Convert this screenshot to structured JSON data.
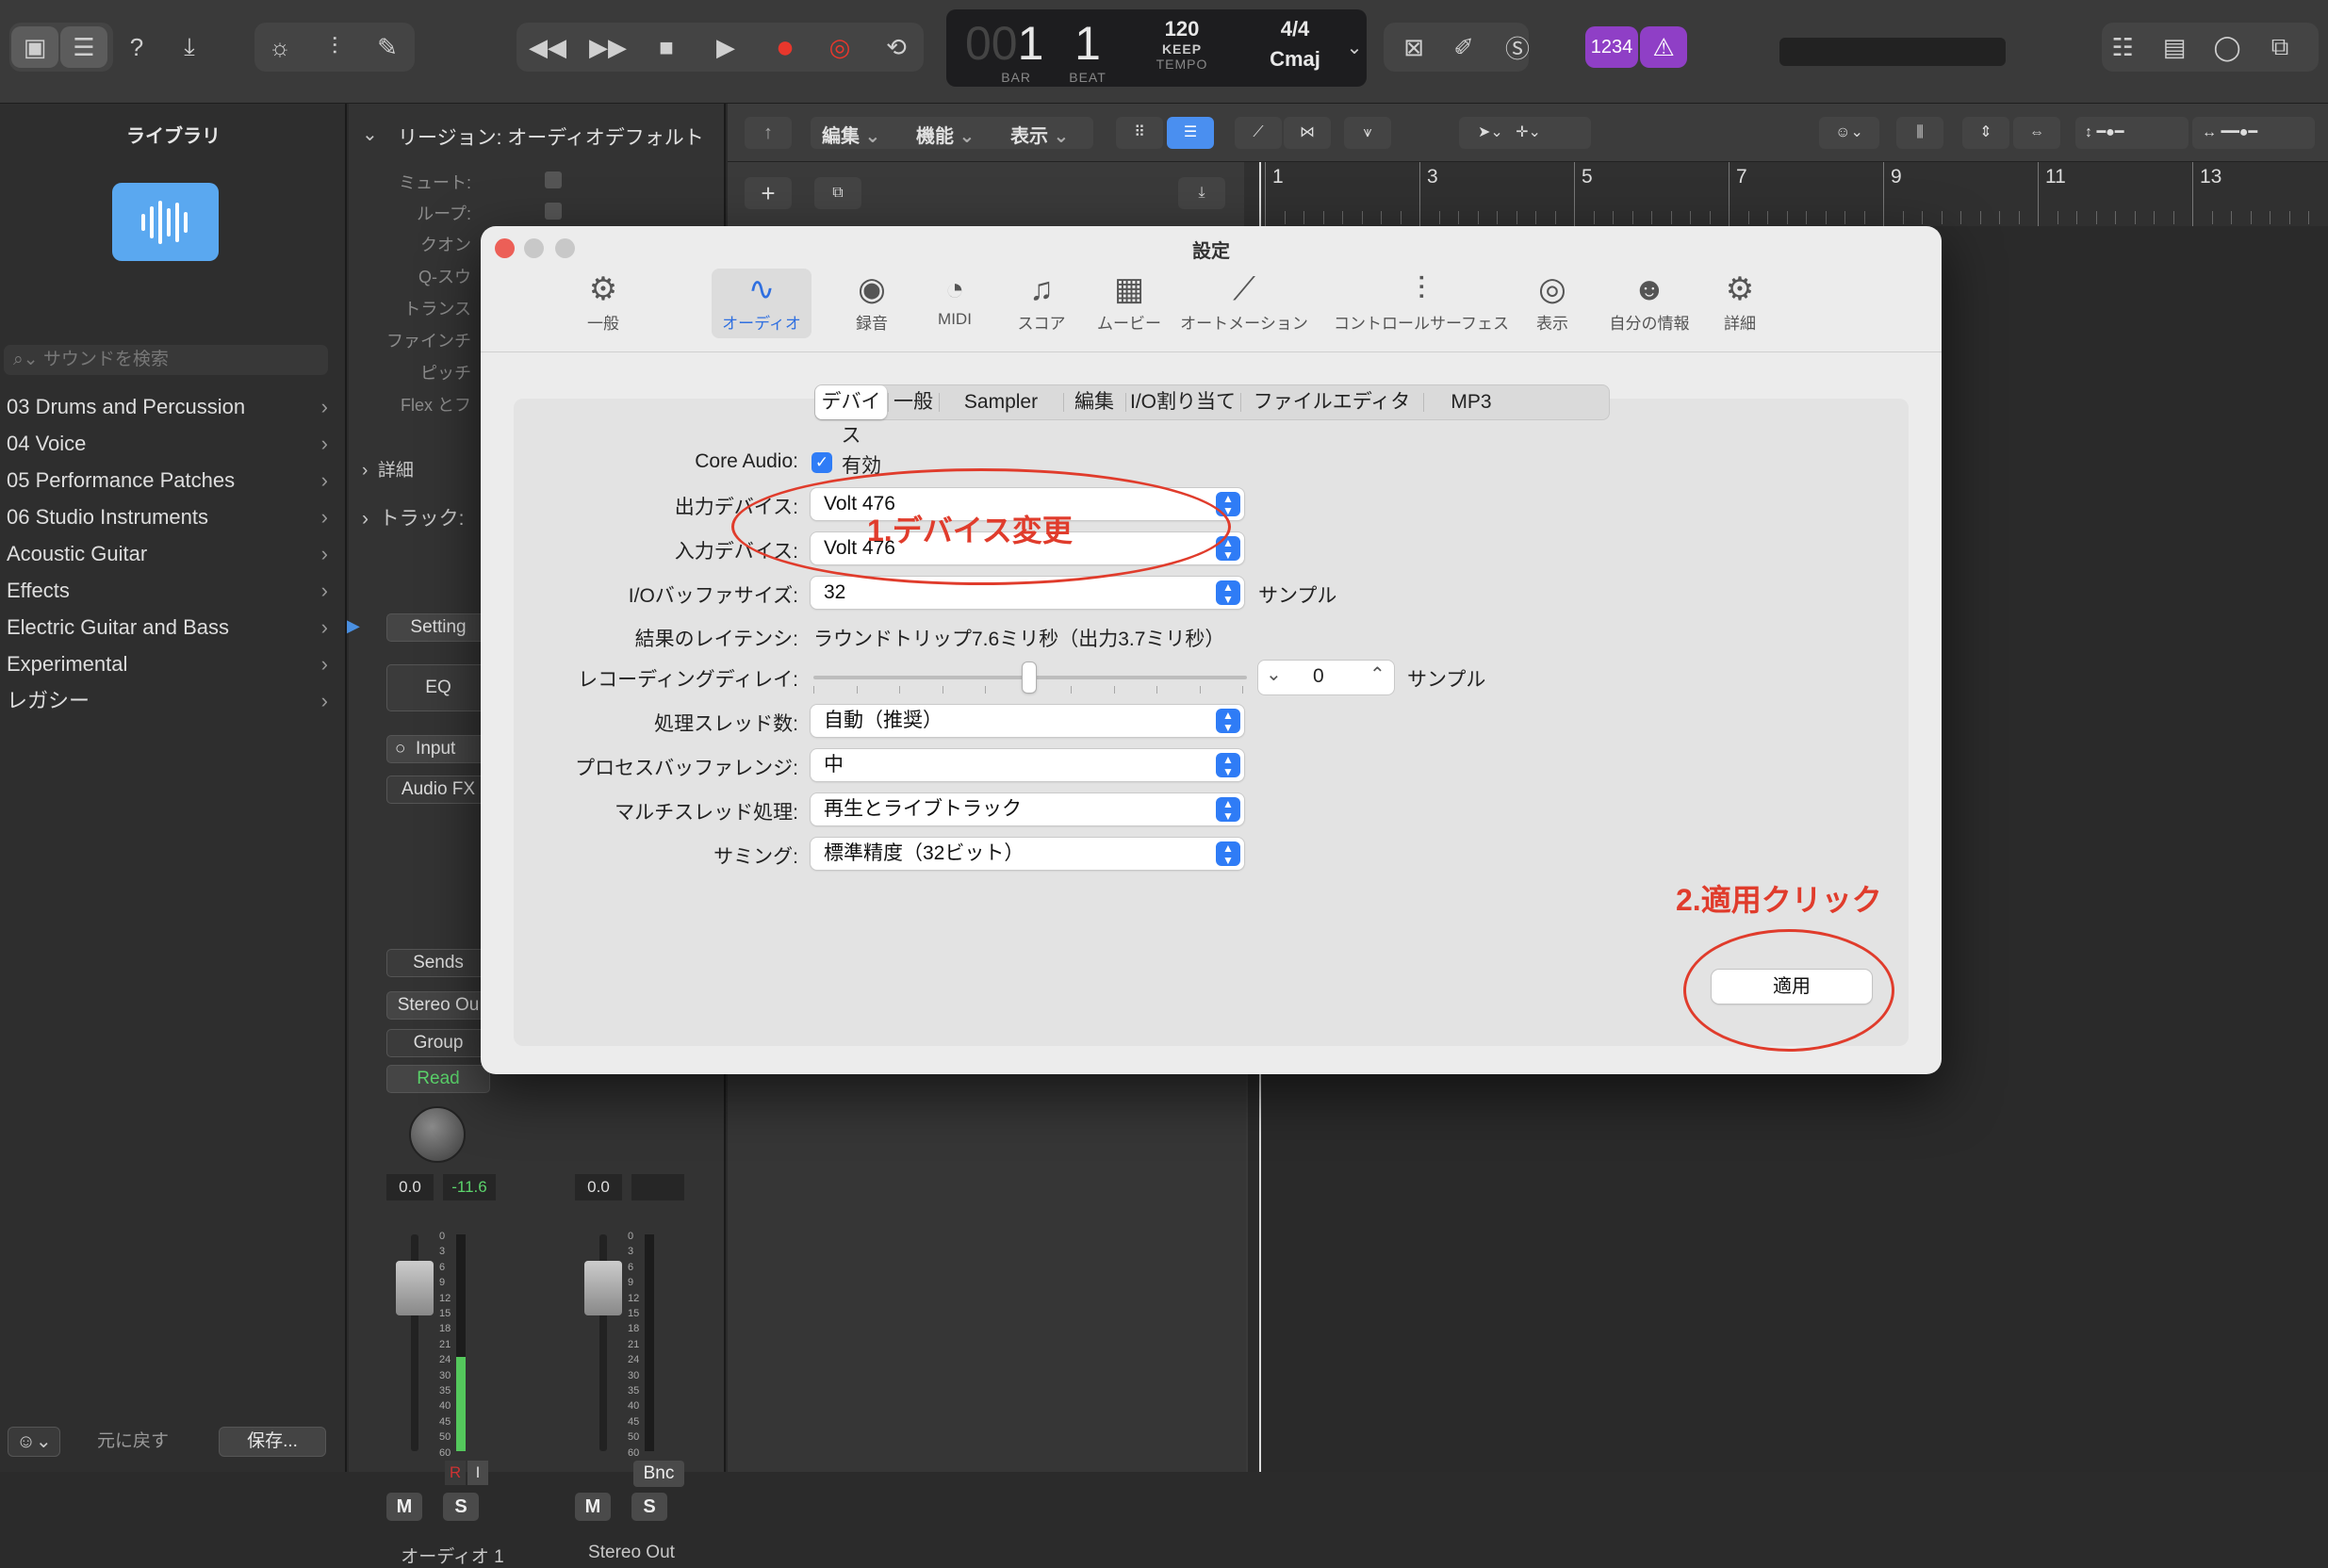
{
  "toolbar": {
    "lcd": {
      "bar": "1",
      "bar_prefix": "00",
      "beat": "1",
      "bar_label": "BAR",
      "beat_label": "BEAT",
      "tempo": "120",
      "tempo_mode": "KEEP",
      "tempo_label": "TEMPO",
      "signature": "4/4",
      "key": "Cmaj"
    },
    "count_in": "1234"
  },
  "library": {
    "title": "ライブラリ",
    "search_placeholder": "サウンドを検索",
    "items": [
      "03 Drums and Percussion",
      "04 Voice",
      "05 Performance Patches",
      "06 Studio Instruments",
      "Acoustic Guitar",
      "Effects",
      "Electric Guitar and Bass",
      "Experimental",
      "レガシー"
    ],
    "revert_label": "元に戻す",
    "save_label": "保存..."
  },
  "inspector": {
    "region_header": "リージョン: オーディオデフォルト",
    "fields": [
      "ミュート:",
      "ループ:",
      "クオン",
      "Q-スウ",
      "トランス",
      "ファインチ",
      "ピッチ",
      "Flex とフ"
    ],
    "detail": "詳細",
    "track": "トラック:",
    "setting": "Setting",
    "eq": "EQ",
    "input": "Input",
    "audio_fx": "Audio FX",
    "sends": "Sends",
    "stereo_out": "Stereo Ou",
    "group": "Group",
    "read": "Read",
    "ch1_vol": "0.0",
    "ch1_peak": "-11.6",
    "ch2_vol": "0.0",
    "meter_ticks": [
      "0",
      "3",
      "6",
      "9",
      "12",
      "15",
      "18",
      "21",
      "24",
      "30",
      "35",
      "40",
      "45",
      "50",
      "60"
    ],
    "r_label": "R",
    "i_label": "I",
    "bnc_label": "Bnc",
    "m_label": "M",
    "s_label": "S",
    "ch1_name": "オーディオ 1",
    "ch2_name": "Stereo Out"
  },
  "tracks": {
    "menus": [
      "編集",
      "機能",
      "表示"
    ],
    "ruler": [
      "1",
      "3",
      "5",
      "7",
      "9",
      "11",
      "13"
    ]
  },
  "dialog": {
    "title": "設定",
    "tabs": [
      {
        "label": "一般",
        "icon": "gear-icon"
      },
      {
        "label": "オーディオ",
        "icon": "waveform-icon"
      },
      {
        "label": "録音",
        "icon": "record-icon"
      },
      {
        "label": "MIDI",
        "icon": "midi-icon"
      },
      {
        "label": "スコア",
        "icon": "notes-icon"
      },
      {
        "label": "ムービー",
        "icon": "film-icon"
      },
      {
        "label": "オートメーション",
        "icon": "automation-icon"
      },
      {
        "label": "コントロールサーフェス",
        "icon": "sliders-icon"
      },
      {
        "label": "表示",
        "icon": "eye-icon"
      },
      {
        "label": "自分の情報",
        "icon": "person-icon"
      },
      {
        "label": "詳細",
        "icon": "advanced-gear-icon"
      }
    ],
    "subtabs": [
      "デバイス",
      "一般",
      "Sampler",
      "編集",
      "I/O割り当て",
      "ファイルエディタ",
      "MP3"
    ],
    "core_audio_label": "Core Audio:",
    "core_audio_value": "有効",
    "output_label": "出力デバイス:",
    "output_value": "Volt 476",
    "input_label": "入力デバイス:",
    "input_value": "Volt 476",
    "buffer_label": "I/Oバッファサイズ:",
    "buffer_value": "32",
    "buffer_unit": "サンプル",
    "latency_label": "結果のレイテンシ:",
    "latency_value": "ラウンドトリップ7.6ミリ秒（出力3.7ミリ秒）",
    "rec_delay_label": "レコーディングディレイ:",
    "rec_delay_value": "0",
    "rec_delay_unit": "サンプル",
    "threads_label": "処理スレッド数:",
    "threads_value": "自動（推奨）",
    "process_buffer_label": "プロセスバッファレンジ:",
    "process_buffer_value": "中",
    "multithread_label": "マルチスレッド処理:",
    "multithread_value": "再生とライブトラック",
    "summing_label": "サミング:",
    "summing_value": "標準精度（32ビット）",
    "apply_label": "適用"
  },
  "annotations": {
    "step1": "1.デバイス変更",
    "step2": "2.適用クリック",
    "color": "#e03c2c"
  }
}
